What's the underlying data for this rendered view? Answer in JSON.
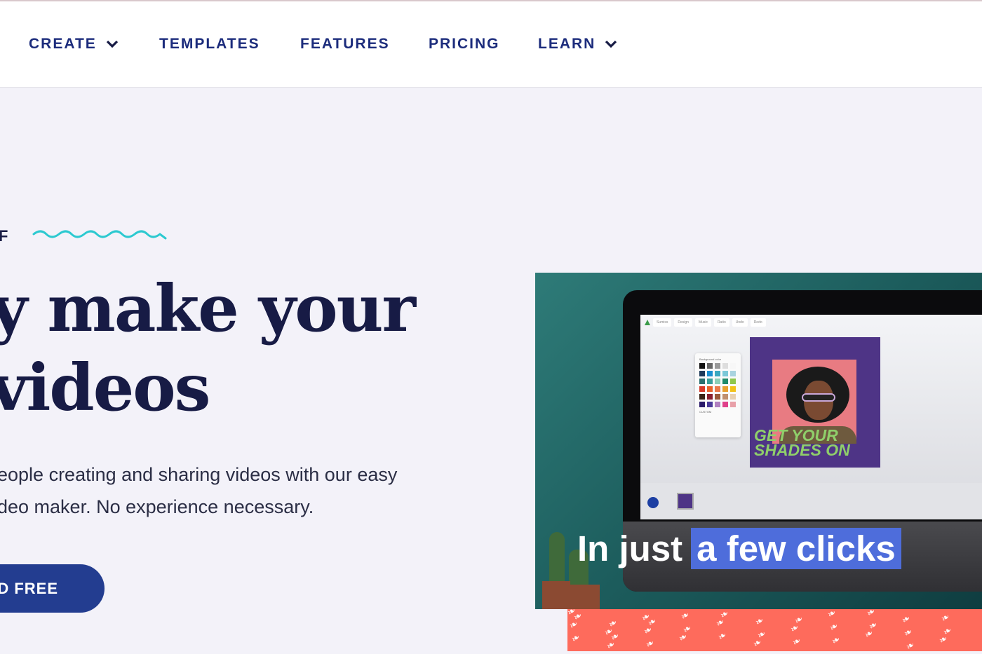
{
  "nav": {
    "items": [
      {
        "label": "CREATE",
        "has_dropdown": true
      },
      {
        "label": "TEMPLATES",
        "has_dropdown": false
      },
      {
        "label": "FEATURES",
        "has_dropdown": false
      },
      {
        "label": "PRICING",
        "has_dropdown": false
      },
      {
        "label": "LEARN",
        "has_dropdown": true
      }
    ]
  },
  "hero": {
    "eyebrow": "F",
    "headline_line1": "y make your",
    "headline_line2": "videos",
    "subtext_line1": "eople creating and sharing videos with our easy",
    "subtext_line2": "deo maker. No experience necessary.",
    "cta_label": "D FREE"
  },
  "video": {
    "caption_plain": "In just",
    "caption_highlight": "a few clicks",
    "promo_line1": "GET YOUR",
    "promo_line2": "SHADES ON",
    "palette_title": "Background color",
    "palette_custom_label": "CUSTOM",
    "toolbar": [
      "Sumiss",
      "Design",
      "Music",
      "Ratio",
      "Undo",
      "Redo"
    ]
  },
  "colors": {
    "nav_text": "#1c2c7c",
    "headline": "#171b45",
    "accent_wave": "#2cc9d0",
    "cta_bg": "#233d90",
    "highlight": "#4e6ddb",
    "coral": "#fe6b5c",
    "page_bg": "#f3f2f9"
  }
}
